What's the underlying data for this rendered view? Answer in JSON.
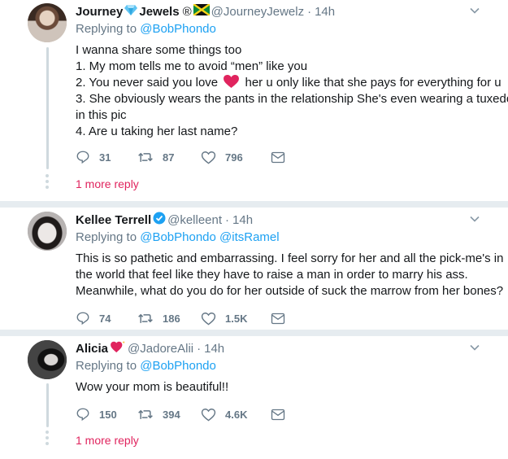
{
  "tweets": [
    {
      "name": "Journey",
      "name2": "Jewels",
      "name_suffix": "®",
      "handle": "@JourneyJewelz",
      "sep": "·",
      "time": "14h",
      "replying_prefix": "Replying to",
      "mentions": [
        "@BobPhondo"
      ],
      "lines": [
        "I wanna share some things too",
        "1. My mom tells me to avoid “men” like you",
        "2. You never said you love",
        "her u only like that she pays for everything for u",
        "3. She obviously wears the pants in the relationship She's even wearing a tuxedo",
        "in this pic",
        "4. Are u taking her last name?"
      ],
      "replies": "31",
      "retweets": "87",
      "likes": "796",
      "more": "1 more reply"
    },
    {
      "name": "Kellee Terrell",
      "handle": "@kelleent",
      "sep": "·",
      "time": "14h",
      "replying_prefix": "Replying to",
      "mentions": [
        "@BobPhondo",
        "@itsRamel"
      ],
      "lines": [
        "This is so pathetic and embarrassing. I feel sorry for her and all the pick-me's in",
        "the world that feel like they have to raise a man in order to marry his ass.",
        "Meanwhile, what do you do for her outside of suck the marrow from her bones?"
      ],
      "replies": "74",
      "retweets": "186",
      "likes": "1.5K"
    },
    {
      "name": "Alicia",
      "handle": "@JadoreAlii",
      "sep": "·",
      "time": "14h",
      "replying_prefix": "Replying to",
      "mentions": [
        "@BobPhondo"
      ],
      "lines": [
        "Wow your mom is beautiful!!"
      ],
      "replies": "150",
      "retweets": "394",
      "likes": "4.6K",
      "more": "1 more reply"
    }
  ],
  "icons": {
    "reply": "reply-icon",
    "retweet": "retweet-icon",
    "like": "like-icon",
    "dm": "direct-message-icon",
    "caret": "chevron-down-icon"
  },
  "colors": {
    "link": "#1da1f2",
    "muted": "#657786",
    "more_reply": "#e0245e",
    "heart": "#e0245e",
    "verified": "#1da1f2"
  }
}
